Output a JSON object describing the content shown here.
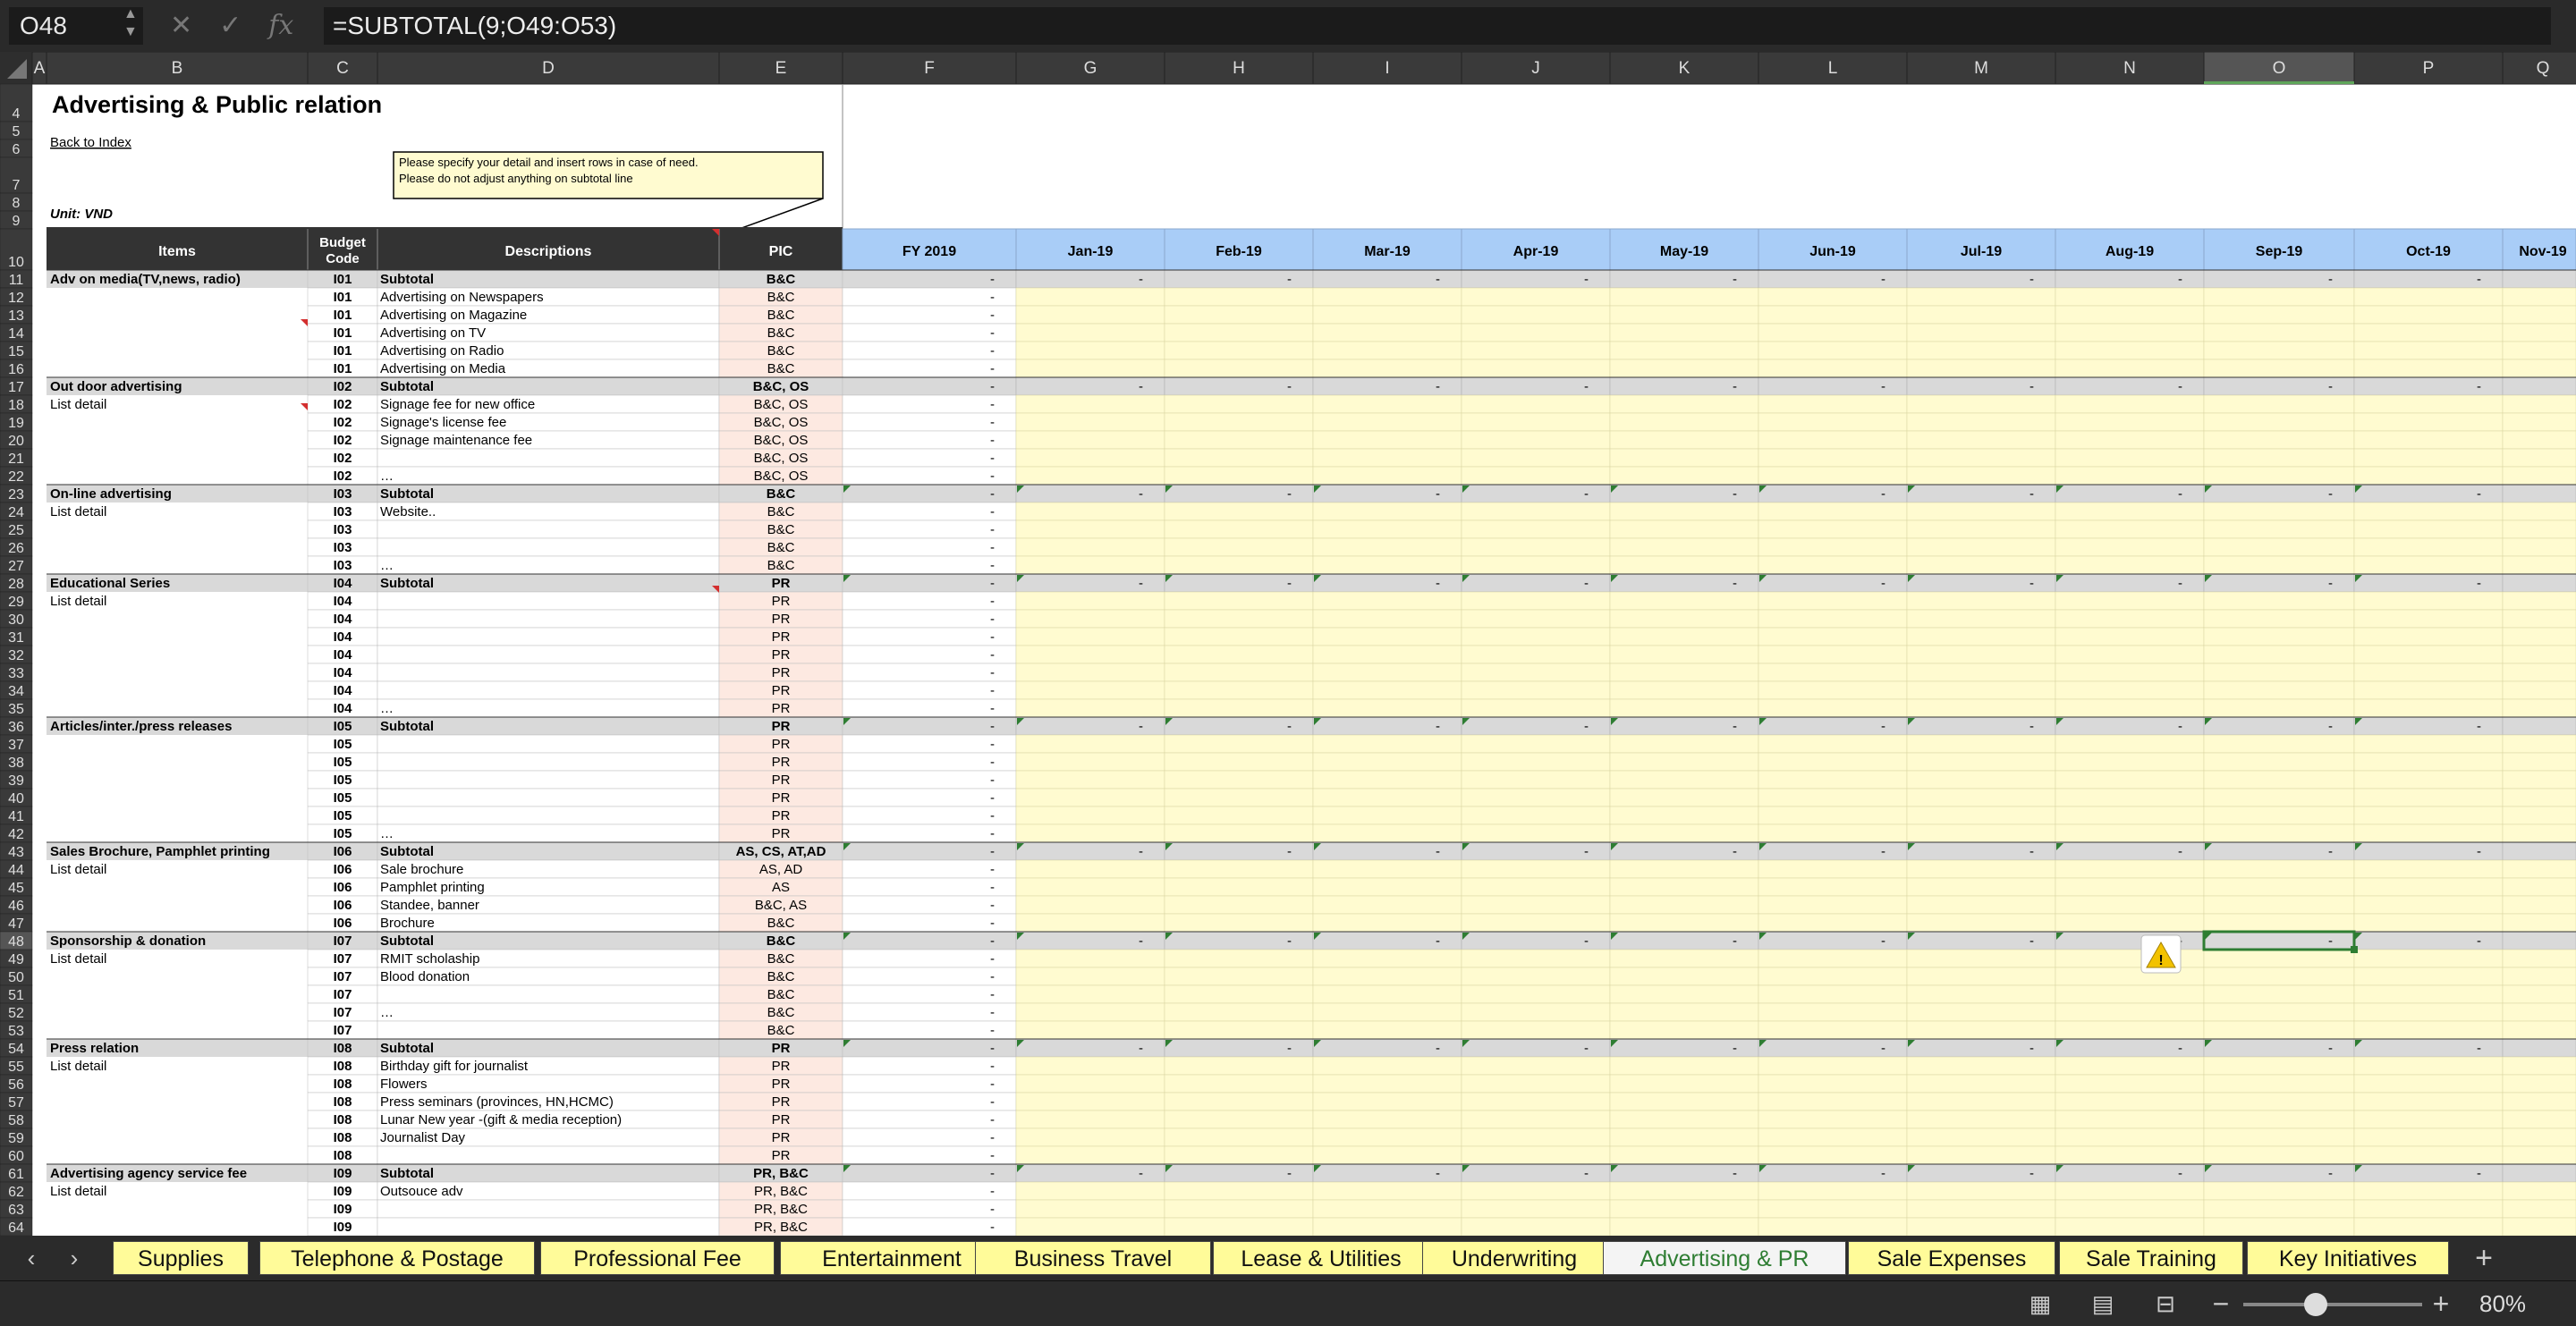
{
  "formula_bar": {
    "cell_ref": "O48",
    "formula": "=SUBTOTAL(9;O49:O53)",
    "icons": [
      "cancel-icon",
      "confirm-icon",
      "function-icon"
    ]
  },
  "columns": [
    "A",
    "B",
    "C",
    "D",
    "E",
    "F",
    "G",
    "H",
    "I",
    "J",
    "K",
    "L",
    "M",
    "N",
    "O",
    "P",
    "Q"
  ],
  "sheet": {
    "title": "Advertising & Public relation",
    "back_link": "Back to Index",
    "unit": "Unit: VND",
    "note_line1": "Please specify your detail and insert rows in case of need.",
    "note_line2": "Please do not adjust anything on subtotal line",
    "headers": {
      "items": "Items",
      "budget_code_1": "Budget",
      "budget_code_2": "Code",
      "descriptions": "Descriptions",
      "pic": "PIC"
    },
    "months": [
      "FY 2019",
      "Jan-19",
      "Feb-19",
      "Mar-19",
      "Apr-19",
      "May-19",
      "Jun-19",
      "Jul-19",
      "Aug-19",
      "Sep-19",
      "Oct-19",
      "Nov-19"
    ],
    "rows": [
      {
        "r": 11,
        "t": "s",
        "item": "Adv on media(TV,news, radio)",
        "code": "I01",
        "desc": "Subtotal",
        "pic": "B&C"
      },
      {
        "r": 12,
        "t": "d",
        "item": "",
        "code": "I01",
        "desc": "Advertising on Newspapers",
        "pic": "B&C"
      },
      {
        "r": 13,
        "t": "d",
        "item": "",
        "code": "I01",
        "desc": "Advertising on Magazine",
        "pic": "B&C"
      },
      {
        "r": 14,
        "t": "d",
        "item": "",
        "code": "I01",
        "desc": "Advertising on TV",
        "pic": "B&C"
      },
      {
        "r": 15,
        "t": "d",
        "item": "",
        "code": "I01",
        "desc": "Advertising on Radio",
        "pic": "B&C"
      },
      {
        "r": 16,
        "t": "d",
        "item": "",
        "code": "I01",
        "desc": "Advertising on Media",
        "pic": "B&C"
      },
      {
        "r": 17,
        "t": "s",
        "item": "Out door advertising",
        "code": "I02",
        "desc": "Subtotal",
        "pic": "B&C, OS"
      },
      {
        "r": 18,
        "t": "d",
        "item": "List detail",
        "code": "I02",
        "desc": "Signage fee for new office",
        "pic": "B&C, OS"
      },
      {
        "r": 19,
        "t": "d",
        "item": "",
        "code": "I02",
        "desc": "Signage's license fee",
        "pic": "B&C, OS"
      },
      {
        "r": 20,
        "t": "d",
        "item": "",
        "code": "I02",
        "desc": "Signage maintenance fee",
        "pic": "B&C, OS"
      },
      {
        "r": 21,
        "t": "d",
        "item": "",
        "code": "I02",
        "desc": "",
        "pic": "B&C, OS"
      },
      {
        "r": 22,
        "t": "d",
        "item": "",
        "code": "I02",
        "desc": "…",
        "pic": "B&C, OS"
      },
      {
        "r": 23,
        "t": "s",
        "item": "On-line advertising",
        "code": "I03",
        "desc": "Subtotal",
        "pic": "B&C"
      },
      {
        "r": 24,
        "t": "d",
        "item": "List detail",
        "code": "I03",
        "desc": "Website..",
        "pic": "B&C"
      },
      {
        "r": 25,
        "t": "d",
        "item": "",
        "code": "I03",
        "desc": "",
        "pic": "B&C"
      },
      {
        "r": 26,
        "t": "d",
        "item": "",
        "code": "I03",
        "desc": "",
        "pic": "B&C"
      },
      {
        "r": 27,
        "t": "d",
        "item": "",
        "code": "I03",
        "desc": "…",
        "pic": "B&C"
      },
      {
        "r": 28,
        "t": "s",
        "item": "Educational Series",
        "code": "I04",
        "desc": "Subtotal",
        "pic": "PR"
      },
      {
        "r": 29,
        "t": "d",
        "item": "List detail",
        "code": "I04",
        "desc": "",
        "pic": "PR"
      },
      {
        "r": 30,
        "t": "d",
        "item": "",
        "code": "I04",
        "desc": "",
        "pic": "PR"
      },
      {
        "r": 31,
        "t": "d",
        "item": "",
        "code": "I04",
        "desc": "",
        "pic": "PR"
      },
      {
        "r": 32,
        "t": "d",
        "item": "",
        "code": "I04",
        "desc": "",
        "pic": "PR"
      },
      {
        "r": 33,
        "t": "d",
        "item": "",
        "code": "I04",
        "desc": "",
        "pic": "PR"
      },
      {
        "r": 34,
        "t": "d",
        "item": "",
        "code": "I04",
        "desc": "",
        "pic": "PR"
      },
      {
        "r": 35,
        "t": "d",
        "item": "",
        "code": "I04",
        "desc": "…",
        "pic": "PR"
      },
      {
        "r": 36,
        "t": "s",
        "item": "Articles/inter./press releases",
        "code": "I05",
        "desc": "Subtotal",
        "pic": "PR"
      },
      {
        "r": 37,
        "t": "d",
        "item": "",
        "code": "I05",
        "desc": "",
        "pic": "PR"
      },
      {
        "r": 38,
        "t": "d",
        "item": "",
        "code": "I05",
        "desc": "",
        "pic": "PR"
      },
      {
        "r": 39,
        "t": "d",
        "item": "",
        "code": "I05",
        "desc": "",
        "pic": "PR"
      },
      {
        "r": 40,
        "t": "d",
        "item": "",
        "code": "I05",
        "desc": "",
        "pic": "PR"
      },
      {
        "r": 41,
        "t": "d",
        "item": "",
        "code": "I05",
        "desc": "",
        "pic": "PR"
      },
      {
        "r": 42,
        "t": "d",
        "item": "",
        "code": "I05",
        "desc": "…",
        "pic": "PR"
      },
      {
        "r": 43,
        "t": "s",
        "item": "Sales Brochure, Pamphlet printing",
        "code": "I06",
        "desc": "Subtotal",
        "pic": "AS, CS, AT,AD"
      },
      {
        "r": 44,
        "t": "d",
        "item": "List detail",
        "code": "I06",
        "desc": "Sale brochure",
        "pic": "AS, AD"
      },
      {
        "r": 45,
        "t": "d",
        "item": "",
        "code": "I06",
        "desc": "Pamphlet printing",
        "pic": "AS"
      },
      {
        "r": 46,
        "t": "d",
        "item": "",
        "code": "I06",
        "desc": "Standee, banner",
        "pic": "B&C, AS"
      },
      {
        "r": 47,
        "t": "d",
        "item": "",
        "code": "I06",
        "desc": "Brochure",
        "pic": "B&C"
      },
      {
        "r": 48,
        "t": "s",
        "item": "Sponsorship & donation",
        "code": "I07",
        "desc": "Subtotal",
        "pic": "B&C"
      },
      {
        "r": 49,
        "t": "d",
        "item": "List detail",
        "code": "I07",
        "desc": "RMIT scholaship",
        "pic": "B&C"
      },
      {
        "r": 50,
        "t": "d",
        "item": "",
        "code": "I07",
        "desc": "Blood donation",
        "pic": "B&C"
      },
      {
        "r": 51,
        "t": "d",
        "item": "",
        "code": "I07",
        "desc": "",
        "pic": "B&C"
      },
      {
        "r": 52,
        "t": "d",
        "item": "",
        "code": "I07",
        "desc": "…",
        "pic": "B&C"
      },
      {
        "r": 53,
        "t": "d",
        "item": "",
        "code": "I07",
        "desc": "",
        "pic": "B&C"
      },
      {
        "r": 54,
        "t": "s",
        "item": "Press relation",
        "code": "I08",
        "desc": "Subtotal",
        "pic": "PR"
      },
      {
        "r": 55,
        "t": "d",
        "item": "List detail",
        "code": "I08",
        "desc": "Birthday gift for journalist",
        "pic": "PR"
      },
      {
        "r": 56,
        "t": "d",
        "item": "",
        "code": "I08",
        "desc": "Flowers",
        "pic": "PR"
      },
      {
        "r": 57,
        "t": "d",
        "item": "",
        "code": "I08",
        "desc": "Press seminars (provinces, HN,HCMC)",
        "pic": "PR"
      },
      {
        "r": 58,
        "t": "d",
        "item": "",
        "code": "I08",
        "desc": "Lunar New year -(gift & media reception)",
        "pic": "PR"
      },
      {
        "r": 59,
        "t": "d",
        "item": "",
        "code": "I08",
        "desc": "Journalist Day",
        "pic": "PR"
      },
      {
        "r": 60,
        "t": "d",
        "item": "",
        "code": "I08",
        "desc": "",
        "pic": "PR"
      },
      {
        "r": 61,
        "t": "s",
        "item": "Advertising agency service fee",
        "code": "I09",
        "desc": "Subtotal",
        "pic": "PR, B&C"
      },
      {
        "r": 62,
        "t": "d",
        "item": "List detail",
        "code": "I09",
        "desc": "Outsouce adv",
        "pic": "PR, B&C"
      },
      {
        "r": 63,
        "t": "d",
        "item": "",
        "code": "I09",
        "desc": "",
        "pic": "PR, B&C"
      },
      {
        "r": 64,
        "t": "d",
        "item": "",
        "code": "I09",
        "desc": "",
        "pic": "PR, B&C"
      }
    ]
  },
  "tabs": [
    {
      "label": "Supplies",
      "active": false
    },
    {
      "label": "Telephone & Postage",
      "active": false
    },
    {
      "label": "Professional Fee",
      "active": false
    },
    {
      "label": "Entertainment",
      "active": false
    },
    {
      "label": "Business Travel",
      "active": false
    },
    {
      "label": "Lease & Utilities",
      "active": false
    },
    {
      "label": "Underwriting",
      "active": false
    },
    {
      "label": "Advertising & PR",
      "active": true
    },
    {
      "label": "Sale Expenses",
      "active": false
    },
    {
      "label": "Sale Training",
      "active": false
    },
    {
      "label": "Key Initiatives",
      "active": false
    }
  ],
  "status": {
    "zoom": "80%",
    "icons": [
      "normal-view-icon",
      "page-layout-icon",
      "page-break-icon",
      "zoom-out-icon",
      "zoom-in-icon"
    ]
  },
  "colors": {
    "header_dark": "#333333",
    "month_header": "#a9cdf7",
    "input_cell": "#fffbd0",
    "pic_cell": "#fde9e1",
    "subtotal": "#d9d9d9",
    "tab": "#fffb99",
    "active_tab_text": "#2e7d32"
  }
}
